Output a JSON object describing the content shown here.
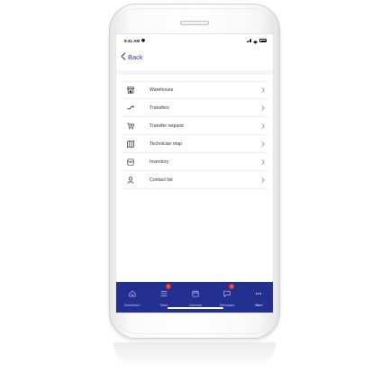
{
  "status_bar": {
    "time": "9:41 AM"
  },
  "nav": {
    "back_label": "Back"
  },
  "menu": {
    "items": [
      {
        "label": "Warehouse",
        "icon": "warehouse-icon"
      },
      {
        "label": "Transfers",
        "icon": "transfers-icon"
      },
      {
        "label": "Transfer request",
        "icon": "cart-add-icon"
      },
      {
        "label": "Technician map",
        "icon": "map-icon"
      },
      {
        "label": "Inventory",
        "icon": "inventory-box-icon"
      },
      {
        "label": "Contact list",
        "icon": "person-icon"
      }
    ]
  },
  "tab_bar": {
    "tabs": [
      {
        "label": "Dashboard",
        "icon": "home-icon"
      },
      {
        "label": "Tasks",
        "icon": "tasks-icon",
        "badge": "1"
      },
      {
        "label": "Calendar",
        "icon": "calendar-icon"
      },
      {
        "label": "Messages",
        "icon": "chat-icon",
        "badge": "4"
      },
      {
        "label": "More",
        "icon": "more-dots-icon",
        "active": true
      }
    ]
  },
  "colors": {
    "accent": "#23308f",
    "badge": "#e5322b",
    "back_link": "#2b3a9a"
  }
}
